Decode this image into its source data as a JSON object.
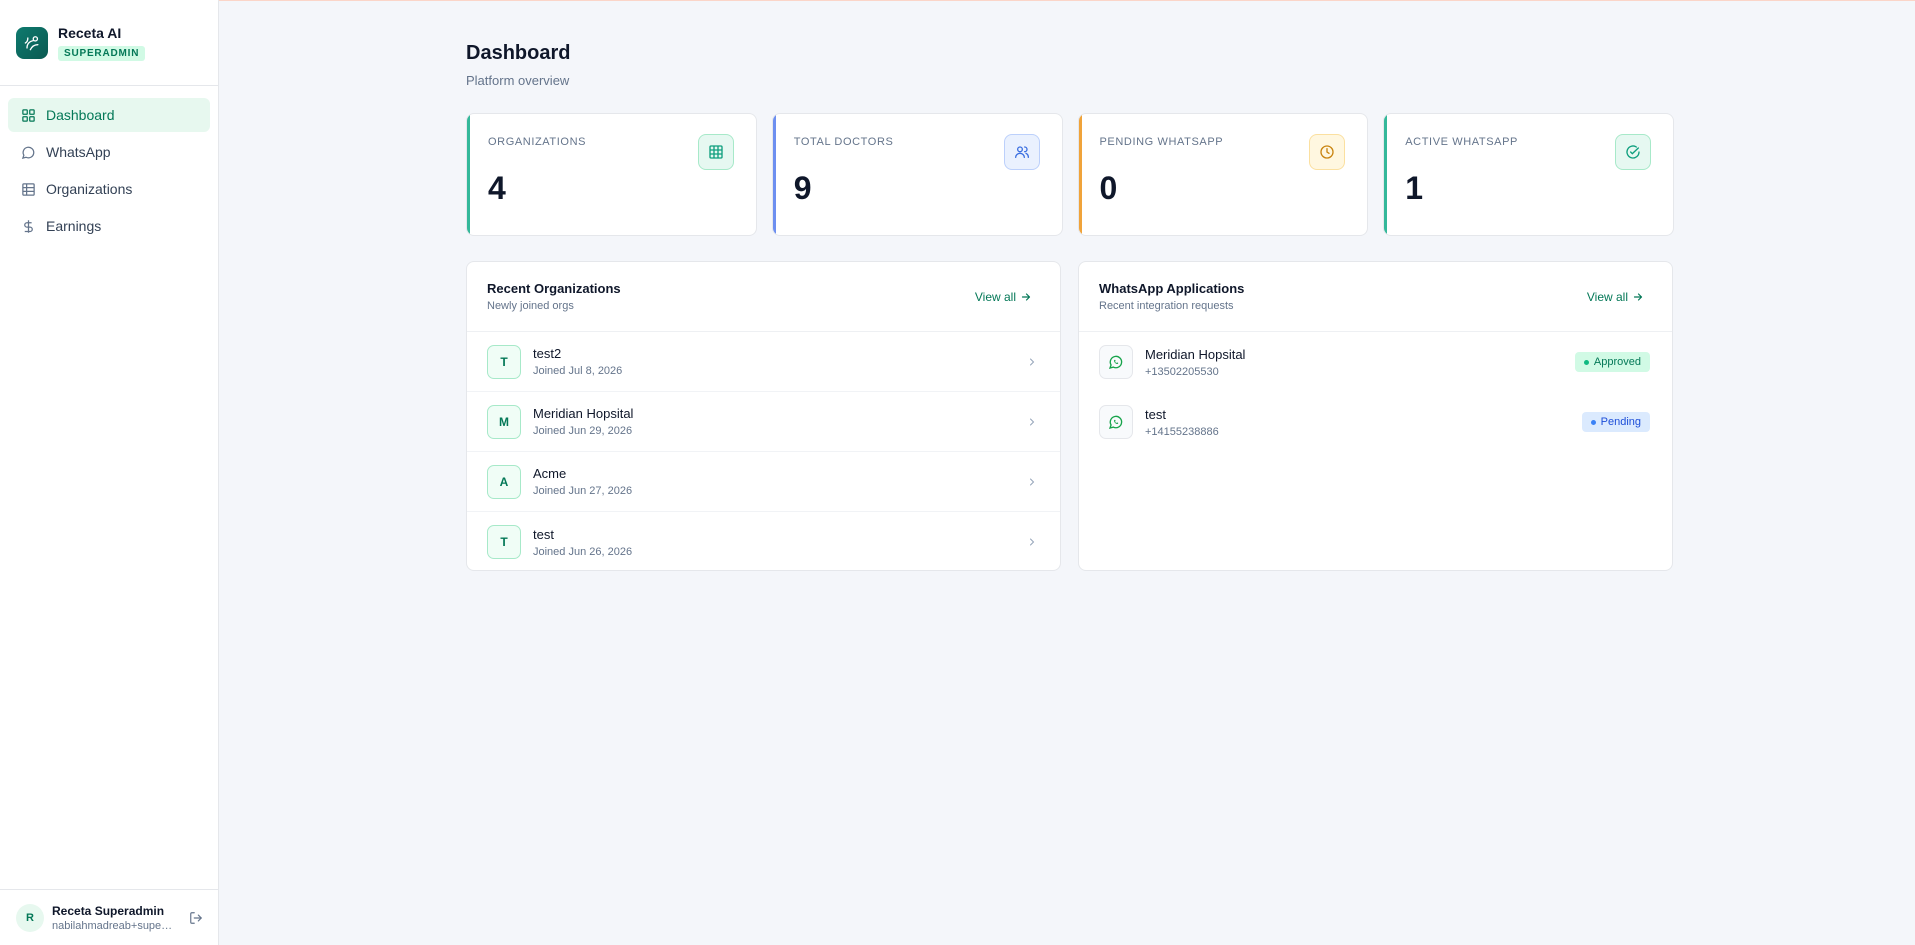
{
  "brand": {
    "name": "Receta AI",
    "role": "SUPERADMIN"
  },
  "nav": [
    {
      "label": "Dashboard",
      "icon": "grid-icon",
      "active": true
    },
    {
      "label": "WhatsApp",
      "icon": "whatsapp-icon",
      "active": false
    },
    {
      "label": "Organizations",
      "icon": "building-icon",
      "active": false
    },
    {
      "label": "Earnings",
      "icon": "dollar-icon",
      "active": false
    }
  ],
  "user": {
    "initial": "R",
    "name": "Receta Superadmin",
    "email": "nabilahmadreab+superadmin@gmail.com"
  },
  "page": {
    "title": "Dashboard",
    "subtitle": "Platform overview"
  },
  "stats": [
    {
      "label": "Organizations",
      "value": "4",
      "accent": "#34b89a",
      "icon": "building-icon"
    },
    {
      "label": "Total Doctors",
      "value": "9",
      "accent": "#6d8ff0",
      "icon": "users-icon"
    },
    {
      "label": "Pending WhatsApp",
      "value": "0",
      "accent": "#f0a33a",
      "icon": "clock-icon"
    },
    {
      "label": "Active WhatsApp",
      "value": "1",
      "accent": "#34b89a",
      "icon": "check-circle-icon"
    }
  ],
  "recent_orgs": {
    "title": "Recent Organizations",
    "subtitle": "Newly joined orgs",
    "view_all": "View all",
    "items": [
      {
        "initial": "T",
        "name": "test2",
        "joined": "Joined Jul 8, 2026"
      },
      {
        "initial": "M",
        "name": "Meridian Hopsital",
        "joined": "Joined Jun 29, 2026"
      },
      {
        "initial": "A",
        "name": "Acme",
        "joined": "Joined Jun 27, 2026"
      },
      {
        "initial": "T",
        "name": "test",
        "joined": "Joined Jun 26, 2026"
      }
    ]
  },
  "whatsapp_apps": {
    "title": "WhatsApp Applications",
    "subtitle": "Recent integration requests",
    "view_all": "View all",
    "items": [
      {
        "name": "Meridian Hopsital",
        "phone": "+13502205530",
        "status": "Approved"
      },
      {
        "name": "test",
        "phone": "+14155238886",
        "status": "Pending"
      }
    ]
  }
}
